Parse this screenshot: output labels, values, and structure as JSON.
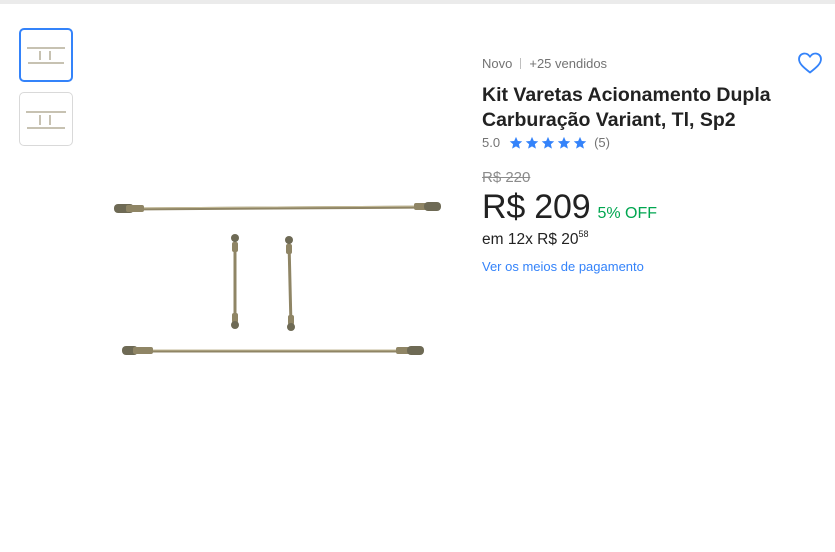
{
  "product": {
    "condition": "Novo",
    "sold": "+25 vendidos",
    "title": "Kit Varetas Acionamento Dupla Carburação Variant, Tl, Sp2",
    "rating_score": "5.0",
    "rating_stars": 5,
    "rating_count": "(5)",
    "old_price": "R$ 220",
    "price": "R$ 209",
    "discount": "5% OFF",
    "installments_prefix": "em 12x R$ 20",
    "installments_cents": "58",
    "payment_link": "Ver os meios de pagamento",
    "favorite_icon": "heart-outline-icon"
  },
  "gallery": {
    "thumbnail_count": 2,
    "selected_index": 0
  },
  "colors": {
    "accent": "#3483fa",
    "discount": "#00a650",
    "star": "#3483fa",
    "rod": "#8f8565"
  }
}
